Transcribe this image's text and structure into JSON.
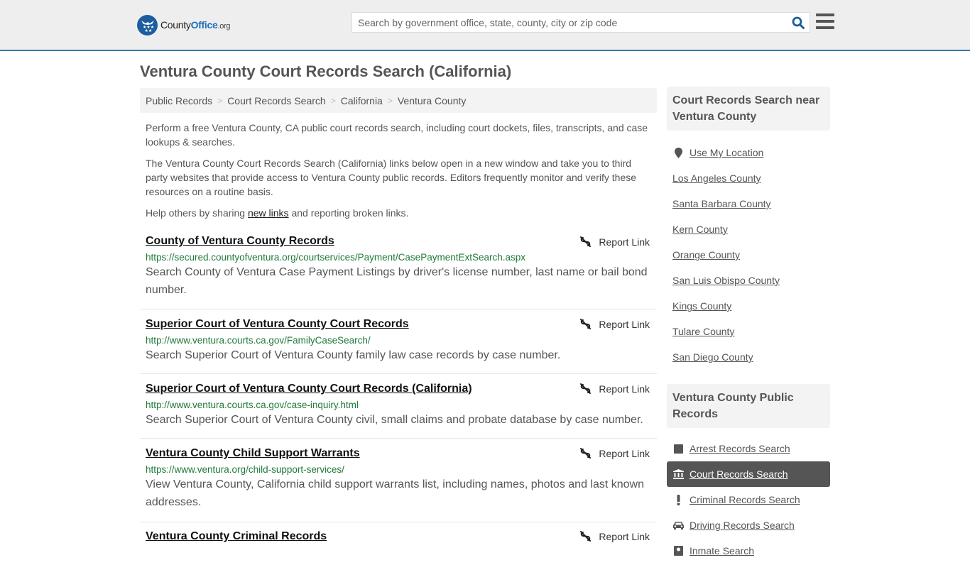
{
  "header": {
    "logo": {
      "name_part1": "County",
      "name_part2": "Office",
      "tld": ".org"
    },
    "search": {
      "placeholder": "Search by government office, state, county, city or zip code",
      "value": ""
    },
    "colors": {
      "brand_blue": "#1c5d9f",
      "accent_border": "#3a7cb0"
    }
  },
  "page": {
    "title": "Ventura County Court Records Search (California)"
  },
  "breadcrumb": [
    {
      "label": "Public Records"
    },
    {
      "label": "Court Records Search"
    },
    {
      "label": "California"
    },
    {
      "label": "Ventura County"
    }
  ],
  "intro": {
    "p1": "Perform a free Ventura County, CA public court records search, including court dockets, files, transcripts, and case lookups & searches.",
    "p2": "The Ventura County Court Records Search (California) links below open in a new window and take you to third party websites that provide access to Ventura County public records. Editors frequently monitor and verify these resources on a routine basis.",
    "p3_before": "Help others by sharing ",
    "p3_link": "new links",
    "p3_after": " and reporting broken links."
  },
  "report_label": "Report Link",
  "results": [
    {
      "title": "County of Ventura County Records",
      "url": "https://secured.countyofventura.org/courtservices/Payment/CasePaymentExtSearch.aspx",
      "description": "Search County of Ventura Case Payment Listings by driver's license number, last name or bail bond number."
    },
    {
      "title": "Superior Court of Ventura County Court Records",
      "url": "http://www.ventura.courts.ca.gov/FamilyCaseSearch/",
      "description": "Search Superior Court of Ventura County family law case records by case number."
    },
    {
      "title": "Superior Court of Ventura County Court Records (California)",
      "url": "http://www.ventura.courts.ca.gov/case-inquiry.html",
      "description": "Search Superior Court of Ventura County civil, small claims and probate database by case number."
    },
    {
      "title": "Ventura County Child Support Warrants",
      "url": "https://www.ventura.org/child-support-services/",
      "description": "View Ventura County, California child support warrants list, including names, photos and last known addresses."
    },
    {
      "title": "Ventura County Criminal Records",
      "url": "",
      "description": ""
    }
  ],
  "sidebar": {
    "nearby": {
      "heading": "Court Records Search near Ventura County",
      "use_location": "Use My Location",
      "items": [
        "Los Angeles County",
        "Santa Barbara County",
        "Kern County",
        "Orange County",
        "San Luis Obispo County",
        "Kings County",
        "Tulare County",
        "San Diego County"
      ]
    },
    "public_records": {
      "heading": "Ventura County Public Records",
      "items": [
        {
          "label": "Arrest Records Search",
          "icon": "square-icon",
          "active": false
        },
        {
          "label": "Court Records Search",
          "icon": "courthouse-icon",
          "active": true
        },
        {
          "label": "Criminal Records Search",
          "icon": "exclamation-icon",
          "active": false
        },
        {
          "label": "Driving Records Search",
          "icon": "car-icon",
          "active": false
        },
        {
          "label": "Inmate Search",
          "icon": "inmate-icon",
          "active": false
        }
      ]
    }
  }
}
